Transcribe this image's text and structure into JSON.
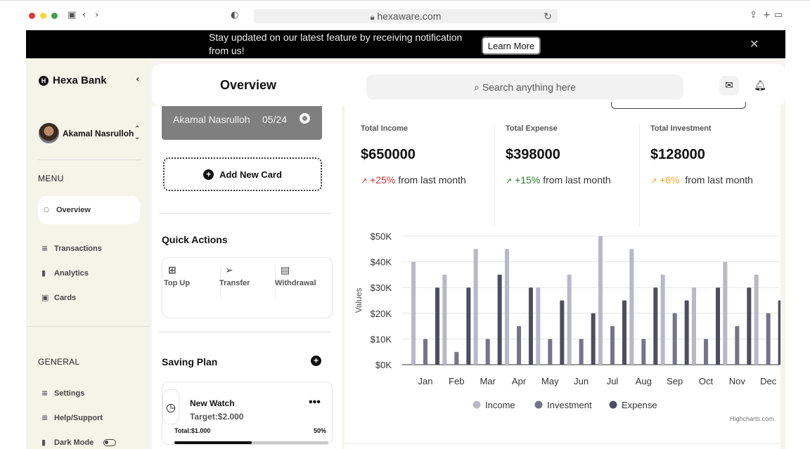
{
  "browser": {
    "url": "hexaware.com"
  },
  "banner": {
    "text": "Stay updated on our latest feature by receiving notification from us!",
    "button": "Learn More"
  },
  "sidebar": {
    "brand": "Hexa Bank",
    "user_name": "Akamal Nasrulloh",
    "menu_label": "MENU",
    "menu_items": [
      "Overview",
      "Transactions",
      "Analytics",
      "Cards"
    ],
    "general_label": "GENERAL",
    "general_items": [
      "Settings",
      "Help/Support",
      "Dark Mode"
    ]
  },
  "header": {
    "title": "Overview",
    "search_placeholder": "Search anything here"
  },
  "card": {
    "holder": "Akamal Nasrulloh",
    "expiry": "05/24",
    "add_label": "Add New Card"
  },
  "quick_actions": {
    "title": "Quick Actions",
    "items": [
      "Top Up",
      "Transfer",
      "Withdrawal"
    ]
  },
  "saving_plan": {
    "title": "Saving Plan",
    "name": "New Watch",
    "target": "Target:$2.000",
    "total": "Total:$1.000",
    "percent": "50%",
    "progress": 0.5
  },
  "stats": [
    {
      "label": "Total Income",
      "value": "$650000",
      "change": "+25%",
      "suffix": "from last month",
      "color": "#d32f2f"
    },
    {
      "label": "Total Expense",
      "value": "$398000",
      "change": "+15%",
      "suffix": "from last month",
      "color": "#2e7d32"
    },
    {
      "label": "Total Investment",
      "value": "$128000",
      "change": "+6%",
      "suffix": "from last month",
      "color": "#f5a623"
    }
  ],
  "chart_data": {
    "type": "bar",
    "ylabel": "Values",
    "ylim": [
      0,
      50000
    ],
    "yticks": [
      "$0K",
      "$10K",
      "$20K",
      "$30K",
      "$40K",
      "$50K"
    ],
    "categories": [
      "Jan",
      "Feb",
      "Mar",
      "Apr",
      "May",
      "Jun",
      "Jul",
      "Aug",
      "Sep",
      "Oct",
      "Nov",
      "Dec"
    ],
    "series": [
      {
        "name": "Income",
        "color": "#b9b8c8",
        "values": [
          40000,
          35000,
          45000,
          45000,
          30000,
          35000,
          50000,
          45000,
          35000,
          30000,
          40000,
          35000
        ]
      },
      {
        "name": "Investment",
        "color": "#75748a",
        "values": [
          10000,
          5000,
          10000,
          15000,
          10000,
          10000,
          15000,
          10000,
          20000,
          10000,
          15000,
          20000
        ]
      },
      {
        "name": "Expense",
        "color": "#4f4e60",
        "values": [
          30000,
          30000,
          35000,
          30000,
          25000,
          20000,
          25000,
          30000,
          25000,
          30000,
          30000,
          25000
        ]
      }
    ],
    "grid": true,
    "legend": "bottom",
    "credit": "Highcharts.com"
  }
}
